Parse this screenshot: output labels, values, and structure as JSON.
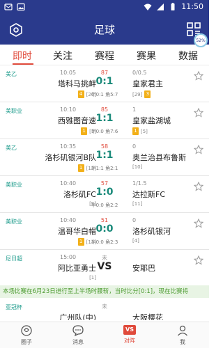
{
  "status_bar": {
    "time": "11:50"
  },
  "app_bar": {
    "title": "足球",
    "progress_badge": "52%"
  },
  "tabs": [
    {
      "label": "即时",
      "active": true
    },
    {
      "label": "关注",
      "active": false
    },
    {
      "label": "赛程",
      "active": false
    },
    {
      "label": "赛果",
      "active": false
    },
    {
      "label": "数据",
      "active": false
    }
  ],
  "matches": [
    {
      "league": "美乙",
      "time": "10:05",
      "minute": "87",
      "odds": "0/0.5",
      "home": "塔科马挑衅",
      "home_card": "4",
      "home_rank": "[26]",
      "score": "0:1",
      "half": "半0:1  角5:7",
      "away": "皇家君主",
      "away_card": "",
      "away_rank": "[29]",
      "away_card2": "3"
    },
    {
      "league": "美职业",
      "time": "10:10",
      "minute": "85",
      "odds": "1",
      "home": "西雅图音速",
      "home_card": "1",
      "home_rank": "[1]",
      "score": "1:1",
      "half": "半0:0  角7:6",
      "away": "皇家盐湖城",
      "away_card": "1",
      "away_rank": "[5]",
      "away_card2": ""
    },
    {
      "league": "美乙",
      "time": "10:35",
      "minute": "58",
      "odds": "0",
      "home": "洛杉矶银河B队",
      "home_card": "1",
      "home_rank": "[12]",
      "score": "1:1",
      "half": "半1:1  角2:1",
      "away": "奥兰治县布鲁斯",
      "away_card": "",
      "away_rank": "[10]",
      "away_card2": ""
    },
    {
      "league": "美职业",
      "time": "10:40",
      "minute": "57",
      "odds": "1/1.5",
      "home": "洛杉矶FC",
      "home_card": "",
      "home_rank": "[9]",
      "score": "1:0",
      "half": "半0:0  角2:2",
      "away": "达拉斯FC",
      "away_card": "",
      "away_rank": "[11]",
      "away_card2": ""
    },
    {
      "league": "美职业",
      "time": "10:40",
      "minute": "51",
      "odds": "0",
      "home": "温哥华白帽",
      "home_card": "1",
      "home_rank": "[13]",
      "score": "0:0",
      "half": "半0:0  角2:3",
      "away": "洛杉矶银河",
      "away_card": "",
      "away_rank": "[4]",
      "away_card2": ""
    },
    {
      "league": "尼日超",
      "time": "15:00",
      "minute": "未",
      "odds": "",
      "home": "阿比亚勇士",
      "home_card": "",
      "home_rank": "[1]",
      "score": "VS",
      "half": "",
      "away": "安耶巴",
      "away_card": "",
      "away_rank": "",
      "away_card2": ""
    }
  ],
  "ticker": "本场比赛在6月23日进行至上半场时腰斩，当时比分[0:1]，现在比赛将",
  "partial_match": {
    "league": "亚冠杯",
    "minute": "未",
    "home": "广州队(中)",
    "away": "大阪樱花"
  },
  "bottom_nav": [
    {
      "label": "圈子",
      "icon": "circle-icon"
    },
    {
      "label": "消息",
      "icon": "message-icon"
    },
    {
      "label": "对阵",
      "icon": "vs-icon",
      "active": true
    },
    {
      "label": "我",
      "icon": "user-icon"
    }
  ],
  "colors": {
    "primary": "#2a3a8c",
    "accent": "#e04a3b",
    "score": "#1a8a7a",
    "league": "#1a9a8a",
    "card": "#f2b019",
    "ticker_bg": "#e8f4e4"
  }
}
